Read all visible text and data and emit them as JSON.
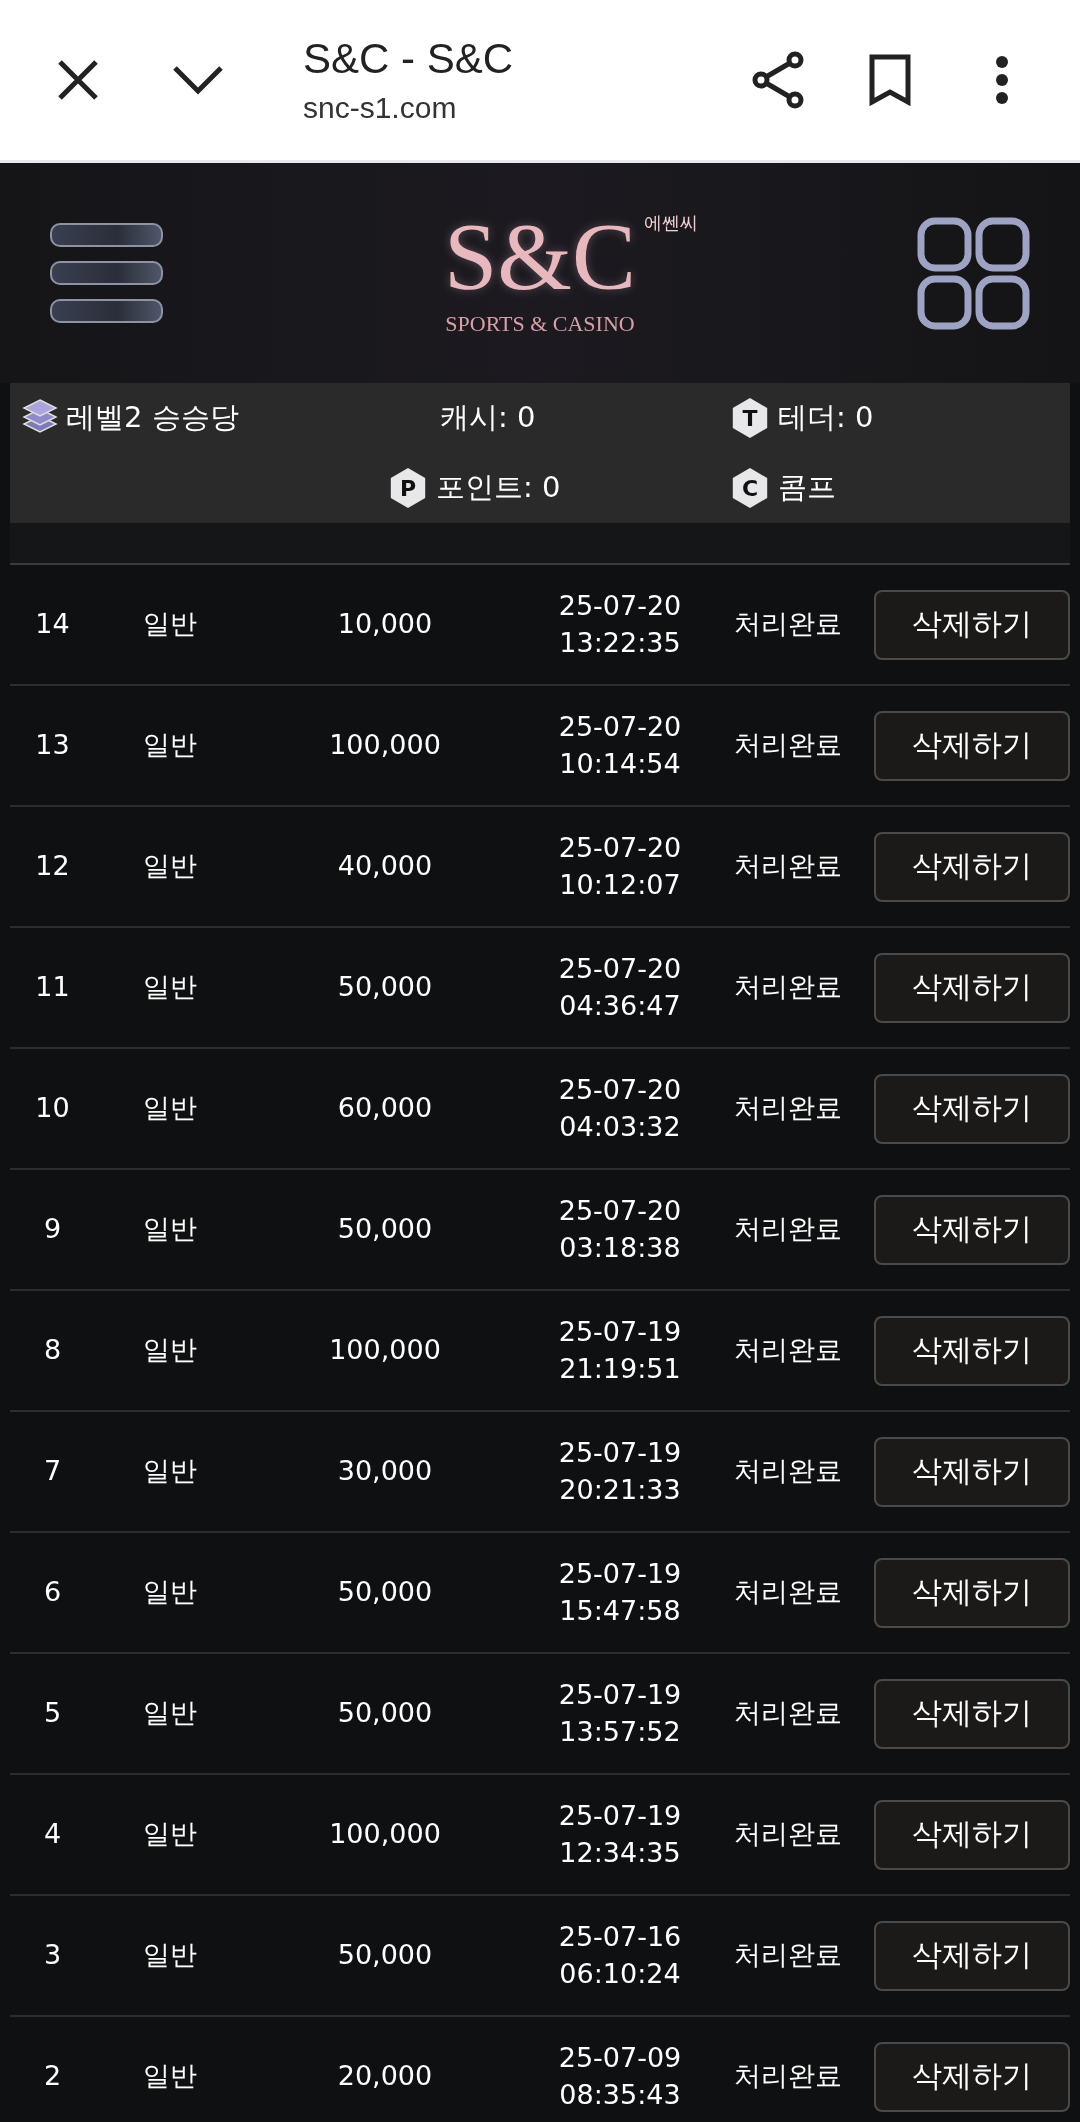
{
  "browser": {
    "title": "S&C - S&C",
    "url": "snc-s1.com"
  },
  "logo": {
    "mark": "S&C",
    "korean": "에쎈씨",
    "tagline": "SPORTS & CASINO"
  },
  "info": {
    "level": "레벨2 승승당",
    "cash": "캐시: 0",
    "tether": {
      "badge": "T",
      "label": "테더: 0"
    },
    "point": {
      "badge": "P",
      "label": "포인트: 0"
    },
    "comp": {
      "badge": "C",
      "label": "콤프"
    }
  },
  "rows": [
    {
      "no": "14",
      "type": "일반",
      "amount": "10,000",
      "date": "25-07-20",
      "time": "13:22:35",
      "status": "처리완료",
      "action": "삭제하기"
    },
    {
      "no": "13",
      "type": "일반",
      "amount": "100,000",
      "date": "25-07-20",
      "time": "10:14:54",
      "status": "처리완료",
      "action": "삭제하기"
    },
    {
      "no": "12",
      "type": "일반",
      "amount": "40,000",
      "date": "25-07-20",
      "time": "10:12:07",
      "status": "처리완료",
      "action": "삭제하기"
    },
    {
      "no": "11",
      "type": "일반",
      "amount": "50,000",
      "date": "25-07-20",
      "time": "04:36:47",
      "status": "처리완료",
      "action": "삭제하기"
    },
    {
      "no": "10",
      "type": "일반",
      "amount": "60,000",
      "date": "25-07-20",
      "time": "04:03:32",
      "status": "처리완료",
      "action": "삭제하기"
    },
    {
      "no": "9",
      "type": "일반",
      "amount": "50,000",
      "date": "25-07-20",
      "time": "03:18:38",
      "status": "처리완료",
      "action": "삭제하기"
    },
    {
      "no": "8",
      "type": "일반",
      "amount": "100,000",
      "date": "25-07-19",
      "time": "21:19:51",
      "status": "처리완료",
      "action": "삭제하기"
    },
    {
      "no": "7",
      "type": "일반",
      "amount": "30,000",
      "date": "25-07-19",
      "time": "20:21:33",
      "status": "처리완료",
      "action": "삭제하기"
    },
    {
      "no": "6",
      "type": "일반",
      "amount": "50,000",
      "date": "25-07-19",
      "time": "15:47:58",
      "status": "처리완료",
      "action": "삭제하기"
    },
    {
      "no": "5",
      "type": "일반",
      "amount": "50,000",
      "date": "25-07-19",
      "time": "13:57:52",
      "status": "처리완료",
      "action": "삭제하기"
    },
    {
      "no": "4",
      "type": "일반",
      "amount": "100,000",
      "date": "25-07-19",
      "time": "12:34:35",
      "status": "처리완료",
      "action": "삭제하기"
    },
    {
      "no": "3",
      "type": "일반",
      "amount": "50,000",
      "date": "25-07-16",
      "time": "06:10:24",
      "status": "처리완료",
      "action": "삭제하기"
    },
    {
      "no": "2",
      "type": "일반",
      "amount": "20,000",
      "date": "25-07-09",
      "time": "08:35:43",
      "status": "처리완료",
      "action": "삭제하기"
    }
  ]
}
